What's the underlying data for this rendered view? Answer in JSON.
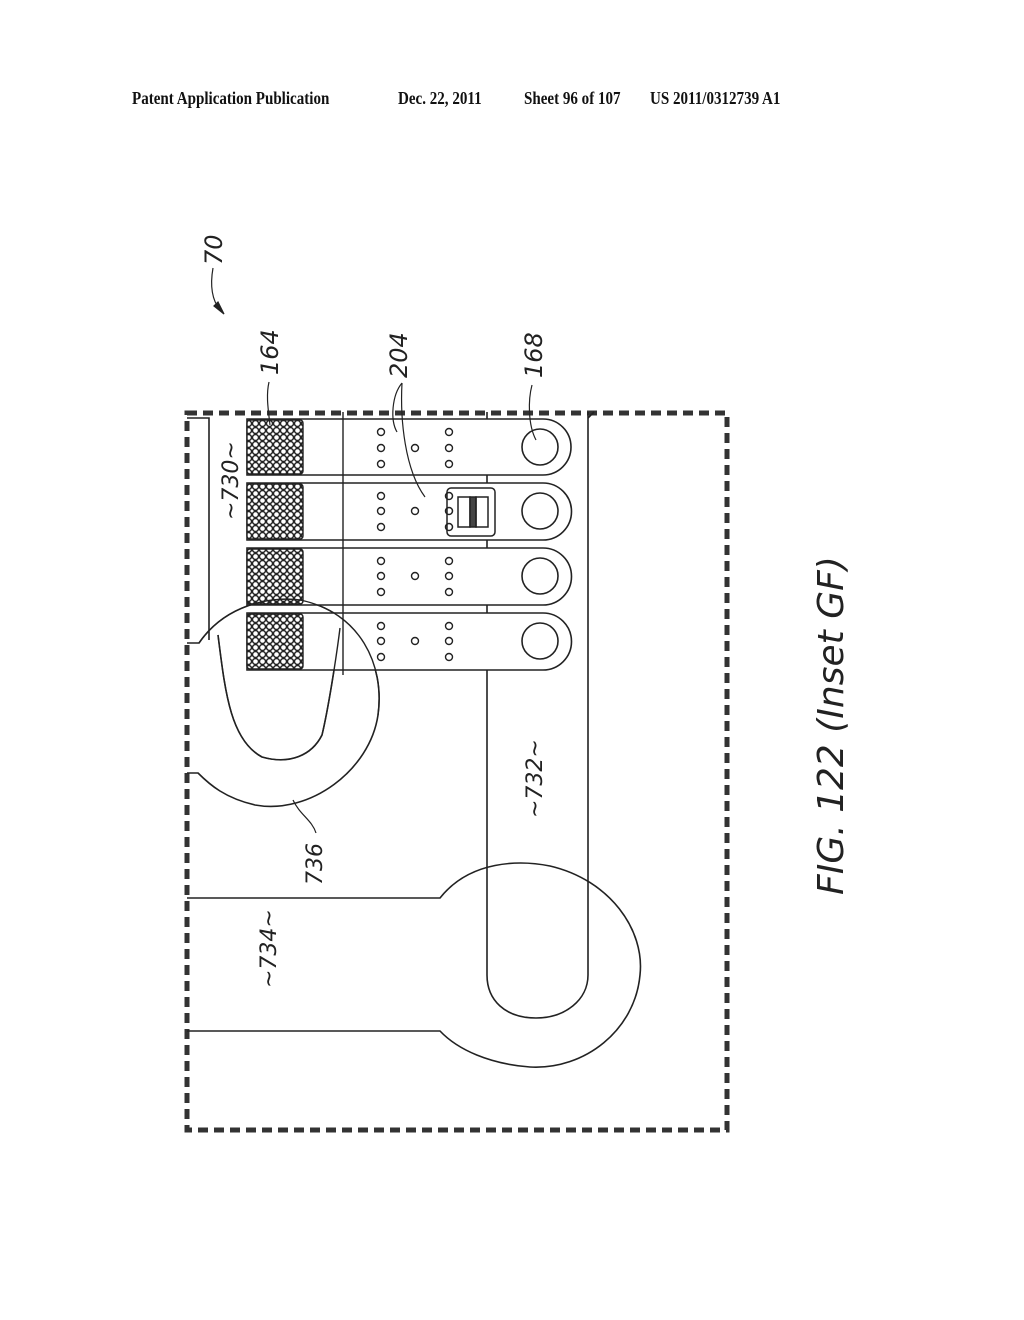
{
  "header": {
    "publication": "Patent Application Publication",
    "date": "Dec. 22, 2011",
    "sheet": "Sheet 96 of 107",
    "number": "US 2011/0312739 A1"
  },
  "figure": {
    "caption": "FIG. 122 (Inset GF)",
    "reference_labels": {
      "assembly": "70",
      "mesh": "164",
      "contacts": "204",
      "hole": "168",
      "region_730": "~730~",
      "region_732": "~732~",
      "region_734": "~734~",
      "region_736": "736"
    },
    "strip_count": 4
  },
  "colors": {
    "ink": "#222222",
    "paper": "#ffffff"
  }
}
